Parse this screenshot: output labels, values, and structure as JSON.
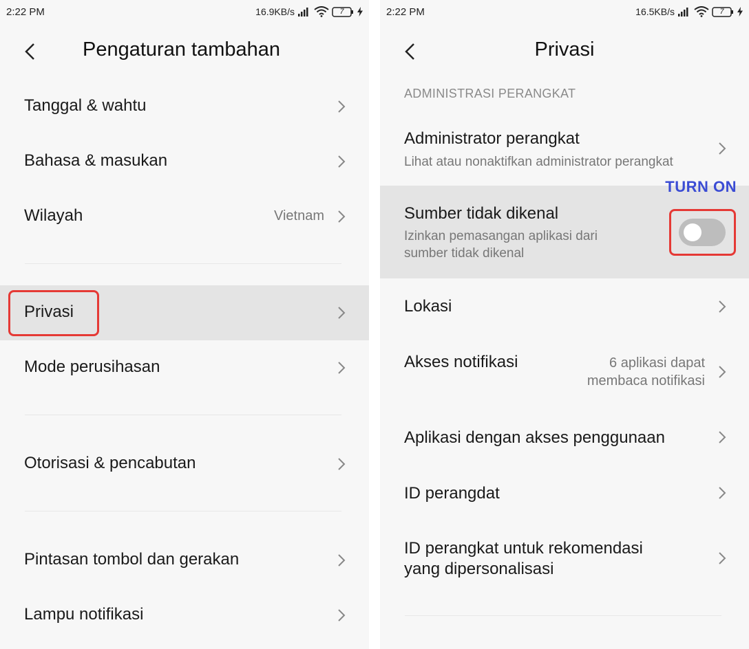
{
  "left_screen": {
    "status": {
      "time": "2:22 PM",
      "speed": "16.9KB/s",
      "battery": "7"
    },
    "title": "Pengaturan tambahan",
    "items": [
      {
        "label": "Tanggal & wahtu"
      },
      {
        "label": "Bahasa & masukan"
      },
      {
        "label": "Wilayah",
        "value": "Vietnam"
      },
      {
        "label": "Privasi"
      },
      {
        "label": "Mode perusihasan"
      },
      {
        "label": "Otorisasi & pencabutan"
      },
      {
        "label": "Pintasan tombol dan gerakan"
      },
      {
        "label": "Lampu notifikasi"
      }
    ]
  },
  "right_screen": {
    "status": {
      "time": "2:22 PM",
      "speed": "16.5KB/s",
      "battery": "7"
    },
    "title": "Privasi",
    "section_header": "ADMINISTRASI PERANGKAT",
    "annotation": "TURN ON",
    "items": [
      {
        "label": "Administrator perangkat",
        "subtitle": "Lihat atau nonaktifkan administrator perangkat"
      },
      {
        "label": "Sumber tidak dikenal",
        "subtitle_line1": "Izinkan pemasangan aplikasi dari",
        "subtitle_line2": "sumber tidak dikenal",
        "toggle_on": false
      },
      {
        "label": "Lokasi"
      },
      {
        "label": "Akses notifikasi",
        "value_line1": "6 aplikasi dapat",
        "value_line2": "membaca notifikasi"
      },
      {
        "label": "Aplikasi dengan akses penggunaan"
      },
      {
        "label": "ID perangdat"
      },
      {
        "label_line1": "ID perangkat untuk rekomendasi",
        "label_line2": "yang dipersonalisasi"
      }
    ]
  },
  "colors": {
    "highlight": "#e53935",
    "annotation": "#3b4cd4",
    "selected_row": "#e4e4e4",
    "toggle_off": "#bdbdbd"
  },
  "icons": [
    "back-arrow-icon",
    "chevron-right-icon",
    "signal-icon",
    "wifi-icon",
    "battery-icon",
    "charging-icon"
  ]
}
